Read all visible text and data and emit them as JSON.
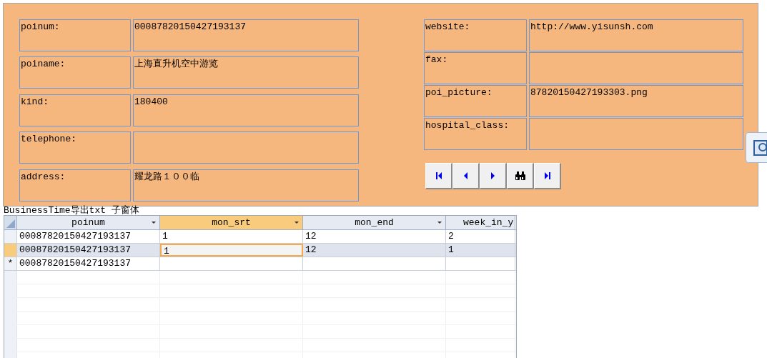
{
  "form": {
    "left_fields": [
      {
        "label": "poinum:",
        "value": "00087820150427193137"
      },
      {
        "label": "poiname:",
        "value": "上海直升机空中游览"
      },
      {
        "label": "kind:",
        "value": "180400"
      },
      {
        "label": "telephone:"
      },
      {
        "label": "address:",
        "value": "耀龙路１００临"
      }
    ],
    "right_fields": [
      {
        "label": "website:",
        "value": "http://www.yisunsh.com"
      },
      {
        "label": "fax:"
      },
      {
        "label": "poi_picture:",
        "value": "87820150427193303.png"
      },
      {
        "label": "hospital_class:"
      }
    ],
    "nav_buttons": [
      {
        "kind": "first"
      },
      {
        "kind": "previous"
      },
      {
        "kind": "next"
      },
      {
        "kind": "find"
      },
      {
        "kind": "last"
      }
    ]
  },
  "subform": {
    "title": "BusinessTime导出txt 子窗体",
    "columns": [
      {
        "label": "poinum",
        "selected": false
      },
      {
        "label": "mon_srt",
        "selected": true
      },
      {
        "label": "mon_end",
        "selected": false
      },
      {
        "label": "week_in_y",
        "selected": false
      }
    ],
    "rows": [
      {
        "selected": false,
        "kind": "record",
        "cells": [
          {
            "text": "00087820150427193137",
            "focused": false
          },
          {
            "text": "1",
            "focused": false
          },
          {
            "text": "12",
            "focused": false
          },
          {
            "text": "2",
            "focused": false
          }
        ]
      },
      {
        "selected": true,
        "kind": "record",
        "cells": [
          {
            "text": "00087820150427193137",
            "focused": false
          },
          {
            "text": "1",
            "focused": true
          },
          {
            "text": "12",
            "focused": false
          },
          {
            "text": "1",
            "focused": false
          }
        ]
      },
      {
        "selected": false,
        "kind": "new",
        "marker": "*",
        "cells": [
          {
            "text": "00087820150427193137",
            "focused": false
          }
        ]
      }
    ]
  }
}
